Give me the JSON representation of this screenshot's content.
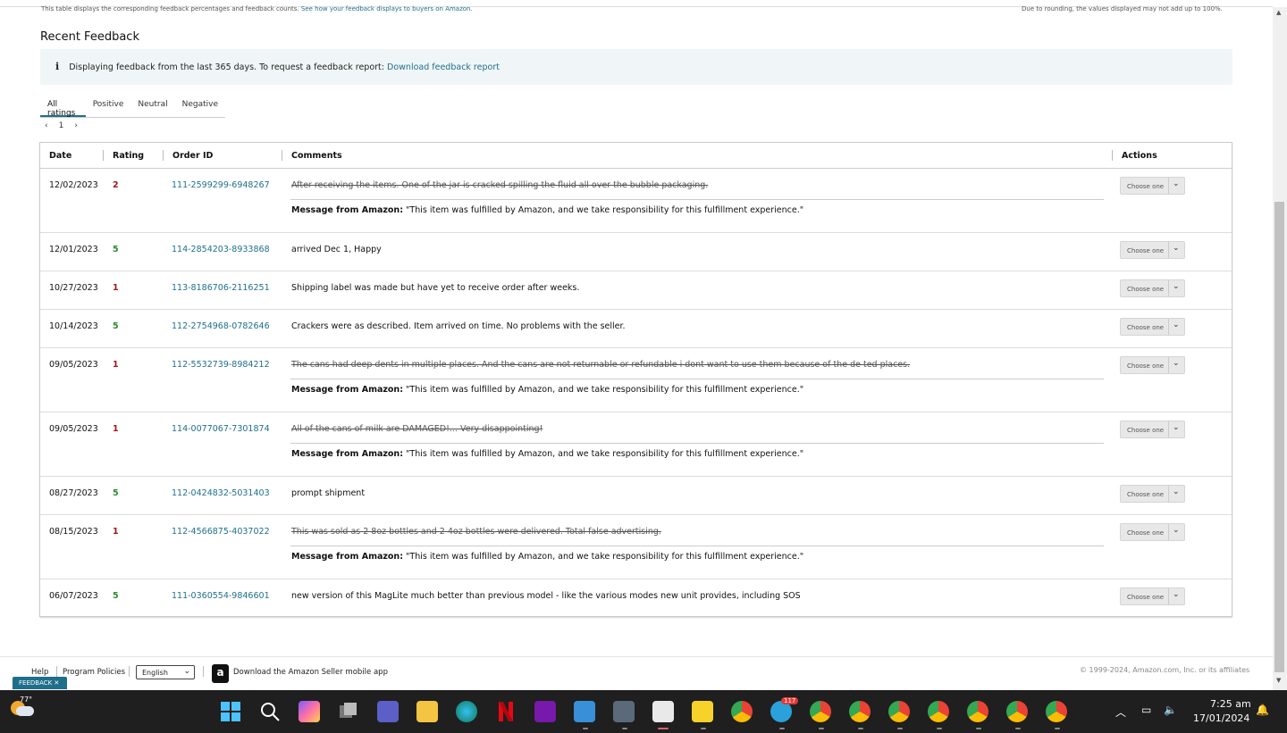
{
  "top_notes": {
    "left_text": "This table displays the corresponding feedback percentages and feedback counts.",
    "left_link": "See how your feedback displays to buyers on Amazon.",
    "right_text": "Due to rounding, the values displayed may not add up to 100%."
  },
  "section_title": "Recent Feedback",
  "info_box": {
    "icon": "i",
    "text": "Displaying feedback from the last 365 days. To request a feedback report:",
    "link": "Download feedback report"
  },
  "tabs": [
    {
      "label": "All ratings",
      "active": true
    },
    {
      "label": "Positive",
      "active": false
    },
    {
      "label": "Neutral",
      "active": false
    },
    {
      "label": "Negative",
      "active": false
    }
  ],
  "pager": {
    "prev": "‹",
    "page": "1",
    "next": "›"
  },
  "table": {
    "headers": {
      "date": "Date",
      "rating": "Rating",
      "order_id": "Order ID",
      "comments": "Comments",
      "actions": "Actions"
    },
    "select_label": "Choose one",
    "message_label": "Message from Amazon:",
    "message_text": "\"This item was fulfilled by Amazon, and we take responsibility for this fulfillment experience.\"",
    "rows": [
      {
        "date": "12/02/2023",
        "rating": "2",
        "order_id": "111-2599299-6948267",
        "comment": "After receiving the items. One of the jar is cracked spilling the fluid all over the bubble packaging.",
        "struck": true
      },
      {
        "date": "12/01/2023",
        "rating": "5",
        "order_id": "114-2854203-8933868",
        "comment": "arrived Dec 1, Happy",
        "struck": false
      },
      {
        "date": "10/27/2023",
        "rating": "1",
        "order_id": "113-8186706-2116251",
        "comment": "Shipping label was made but have yet to receive order after weeks.",
        "struck": false
      },
      {
        "date": "10/14/2023",
        "rating": "5",
        "order_id": "112-2754968-0782646",
        "comment": "Crackers were as described. Item arrived on time. No problems with the seller.",
        "struck": false
      },
      {
        "date": "09/05/2023",
        "rating": "1",
        "order_id": "112-5532739-8984212",
        "comment": "The cans had deep dents in multiple places. And the cans are not returnable or refundable i dont want to use them because of the de ted places.",
        "struck": true
      },
      {
        "date": "09/05/2023",
        "rating": "1",
        "order_id": "114-0077067-7301874",
        "comment": "All of the cans of milk are DAMAGED!... Very disappointing!",
        "struck": true
      },
      {
        "date": "08/27/2023",
        "rating": "5",
        "order_id": "112-0424832-5031403",
        "comment": "prompt shipment",
        "struck": false
      },
      {
        "date": "08/15/2023",
        "rating": "1",
        "order_id": "112-4566875-4037022",
        "comment": "This was sold as 2 8oz bottles and 2 4oz bottles were delivered. Total false advertising.",
        "struck": true
      },
      {
        "date": "06/07/2023",
        "rating": "5",
        "order_id": "111-0360554-9846601",
        "comment": "new version of this MagLite much better than previous model - like the various modes new unit provides, including SOS",
        "struck": false
      }
    ]
  },
  "footer": {
    "help": "Help",
    "program_policies": "Program Policies",
    "language": "English",
    "app_icon": "a",
    "app_text": "Download the Amazon Seller mobile app",
    "copyright": "© 1999-2024, Amazon.com, Inc. or its affiliates"
  },
  "feedback_tab": "FEEDBACK ✕",
  "taskbar": {
    "temperature": "77°",
    "telegram_badge": "117",
    "time": "7:25 am",
    "date": "17/01/2024",
    "colors": {
      "bg": "#1f1f1f",
      "accent": "#1f6f8b"
    }
  }
}
